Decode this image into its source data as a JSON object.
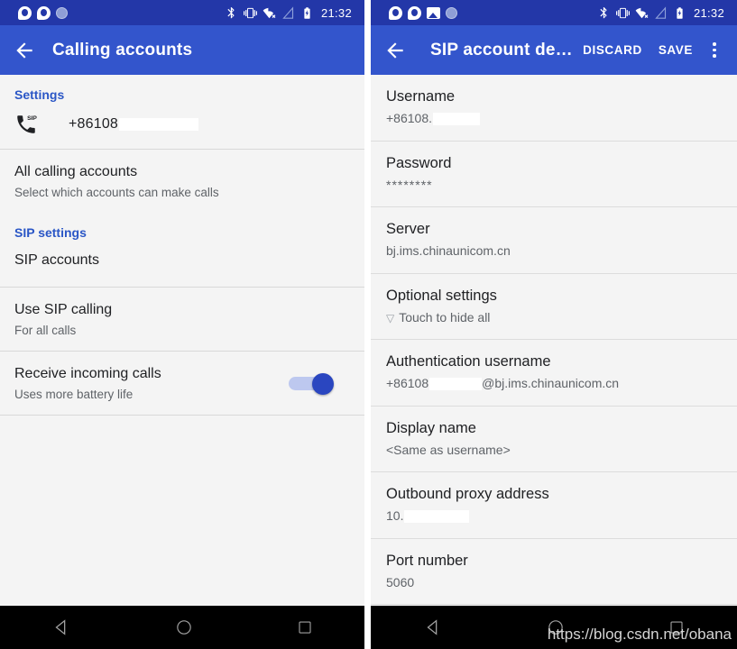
{
  "status_bar": {
    "time": "21:32",
    "left_icons_left_panel": [
      "qq-icon",
      "qq-icon",
      "circle-icon"
    ],
    "left_icons_right_panel": [
      "qq-icon",
      "qq-icon",
      "image-icon",
      "circle-icon"
    ],
    "right_icons": [
      "bluetooth-icon",
      "vibrate-icon",
      "wifi-off-icon",
      "signal-off-icon",
      "battery-charging-icon"
    ]
  },
  "colors": {
    "status_bar": "#2337a8",
    "app_bar": "#3355cc",
    "accent": "#2a56c6",
    "toggle_on": "#2a46c0",
    "toggle_track": "#bdc8ef",
    "background": "#f4f4f4",
    "divider": "#dcdcdc",
    "primary_text": "#202124",
    "secondary_text": "#5f6368"
  },
  "left_panel": {
    "app_bar": {
      "title": "Calling accounts",
      "back": "back-arrow"
    },
    "settings_header": "Settings",
    "account": {
      "icon": "sip-phone-icon",
      "number": "+86108",
      "redacted": true
    },
    "rows": [
      {
        "title": "All calling accounts",
        "subtitle": "Select which accounts can make calls"
      }
    ],
    "sip_settings_header": "SIP settings",
    "sip_rows": [
      {
        "title": "SIP accounts",
        "subtitle": ""
      }
    ],
    "toggle_rows": [
      {
        "title": "Use SIP calling",
        "subtitle": "For all calls",
        "toggle": false,
        "has_toggle": false
      },
      {
        "title": "Receive incoming calls",
        "subtitle": "Uses more battery life",
        "toggle": true,
        "has_toggle": true
      }
    ]
  },
  "right_panel": {
    "app_bar": {
      "title": "SIP account de…",
      "back": "back-arrow",
      "discard_label": "DISCARD",
      "save_label": "SAVE",
      "overflow": "more-options-icon"
    },
    "fields": [
      {
        "label": "Username",
        "value": "+86108.",
        "redacted": true,
        "redact_width": 58
      },
      {
        "label": "Password",
        "value": "********",
        "redacted": false,
        "masked": true
      },
      {
        "label": "Server",
        "value": "bj.ims.chinaunicom.cn",
        "redacted": false
      },
      {
        "label": "Optional settings",
        "value": "Touch to hide all",
        "prefix": "▽",
        "redacted": false
      },
      {
        "label": "Authentication username",
        "value": "+86108",
        "suffix": "@bj.ims.chinaunicom.cn",
        "redacted": true,
        "redact_width": 62
      },
      {
        "label": "Display name",
        "value": "<Same as username>",
        "redacted": false
      },
      {
        "label": "Outbound proxy address",
        "value": "10.",
        "redacted": true,
        "redact_width": 78
      },
      {
        "label": "Port number",
        "value": "5060",
        "redacted": false
      }
    ]
  },
  "nav_bar": {
    "buttons": [
      "back-triangle-icon",
      "home-circle-icon",
      "recents-square-icon"
    ]
  },
  "watermark": "https://blog.csdn.net/obana"
}
